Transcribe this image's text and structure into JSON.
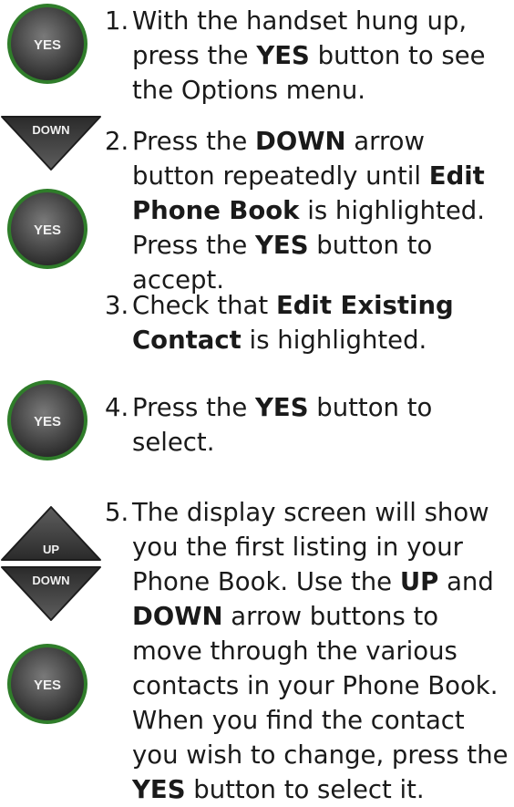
{
  "buttons": {
    "yes": "YES",
    "down": "DOWN",
    "up": "UP"
  },
  "steps": [
    {
      "n": "1.",
      "a": "With the handset hung up, press the ",
      "b": "YES",
      "c": " button to see the Options menu."
    },
    {
      "n": "2.",
      "a": "Press the ",
      "b": "DOWN",
      "c": " arrow button repeatedly until ",
      "d": "Edit Phone Book",
      "e": " is highlighted. Press the ",
      "f": "YES",
      "g": " button to accept."
    },
    {
      "n": "3.",
      "a": "Check that ",
      "b": "Edit Existing Contact",
      "c": " is highlighted."
    },
    {
      "n": "4.",
      "a": "Press the ",
      "b": "YES",
      "c": " button to select."
    },
    {
      "n": "5.",
      "a": "The display screen will show you the first listing in your Phone Book. Use the ",
      "b": "UP",
      "c": " and ",
      "d": "DOWN",
      "e": " arrow buttons to move through the various contacts in your Phone Book. When you find the contact you wish to change, press the ",
      "f": "YES",
      "g": " button to select it."
    }
  ]
}
